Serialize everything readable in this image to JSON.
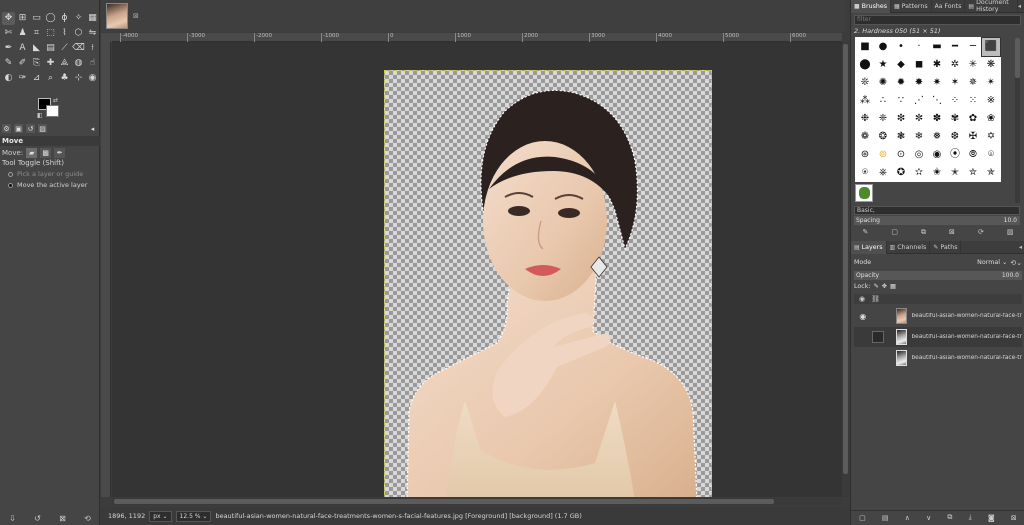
{
  "toolbox": {
    "tools": [
      {
        "name": "move-tool-icon",
        "glyph": "✥",
        "active": true
      },
      {
        "name": "align-tool-icon",
        "glyph": "⊞"
      },
      {
        "name": "rect-select-icon",
        "glyph": "▭"
      },
      {
        "name": "ellipse-select-icon",
        "glyph": "◯"
      },
      {
        "name": "free-select-icon",
        "glyph": "ϕ"
      },
      {
        "name": "fuzzy-select-icon",
        "glyph": "✧"
      },
      {
        "name": "select-by-color-icon",
        "glyph": "▦"
      },
      {
        "name": "scissors-select-icon",
        "glyph": "✄"
      },
      {
        "name": "foreground-select-icon",
        "glyph": "♟"
      },
      {
        "name": "crop-icon",
        "glyph": "⌗"
      },
      {
        "name": "unified-transform-icon",
        "glyph": "⬚"
      },
      {
        "name": "warp-transform-icon",
        "glyph": "⌇"
      },
      {
        "name": "cage-transform-icon",
        "glyph": "⬡"
      },
      {
        "name": "flip-icon",
        "glyph": "⇋"
      },
      {
        "name": "paths-icon",
        "glyph": "✒"
      },
      {
        "name": "text-icon",
        "glyph": "A"
      },
      {
        "name": "bucket-fill-icon",
        "glyph": "◣"
      },
      {
        "name": "gradient-icon",
        "glyph": "▤"
      },
      {
        "name": "paintbrush-icon",
        "glyph": "⟋"
      },
      {
        "name": "eraser-icon",
        "glyph": "⌫"
      },
      {
        "name": "airbrush-icon",
        "glyph": "⟊"
      },
      {
        "name": "ink-icon",
        "glyph": "✎"
      },
      {
        "name": "mypaint-brush-icon",
        "glyph": "✐"
      },
      {
        "name": "clone-icon",
        "glyph": "⎘"
      },
      {
        "name": "heal-icon",
        "glyph": "✚"
      },
      {
        "name": "perspective-clone-icon",
        "glyph": "⟁"
      },
      {
        "name": "blur-icon",
        "glyph": "◍"
      },
      {
        "name": "smudge-icon",
        "glyph": "☝"
      },
      {
        "name": "dodge-burn-icon",
        "glyph": "◐"
      },
      {
        "name": "color-picker-icon",
        "glyph": "✑"
      },
      {
        "name": "measure-icon",
        "glyph": "⊿"
      },
      {
        "name": "zoom-icon",
        "glyph": "⌕"
      },
      {
        "name": "levels-icon",
        "glyph": "♣"
      },
      {
        "name": "handle-transform-icon",
        "glyph": "⊹"
      },
      {
        "name": "threshold-icon",
        "glyph": "◉"
      }
    ],
    "options_title": "Move",
    "move_label": "Move:",
    "tool_toggle": "Tool Toggle  (Shift)",
    "option_pick": "Pick a layer or guide",
    "option_move": "Move the active layer"
  },
  "canvas": {
    "ruler_ticks": [
      "-4000",
      "-3000",
      "-2000",
      "-1000",
      "0",
      "1000",
      "2000",
      "3000",
      "4000",
      "5000",
      "6000"
    ],
    "image_file": "beautiful-asian-women-natural-face-treatments-women-s-facial-features.jpg"
  },
  "status": {
    "coords": "1896, 1192",
    "unit": "px",
    "zoom": "12.5 %",
    "message": "beautiful-asian-women-natural-face-treatments-women-s-facial-features.jpg [Foreground] [background] (1.7 GB)"
  },
  "dock": {
    "top_tabs": [
      {
        "name": "tab-brushes",
        "icon": "■",
        "label": "Brushes"
      },
      {
        "name": "tab-patterns",
        "icon": "▦",
        "label": "Patterns"
      },
      {
        "name": "tab-fonts",
        "icon": "Aa",
        "label": "Fonts"
      },
      {
        "name": "tab-document-history",
        "icon": "▤",
        "label": "Document History"
      }
    ],
    "filter_placeholder": "filter",
    "brush_name": "2. Hardness 050 (51 × 51)",
    "brush_tag": "Basic,",
    "spacing_label": "Spacing",
    "spacing_value": "10.0",
    "layer_tabs": [
      {
        "name": "tab-layers",
        "icon": "▤",
        "label": "Layers"
      },
      {
        "name": "tab-channels",
        "icon": "▥",
        "label": "Channels"
      },
      {
        "name": "tab-paths",
        "icon": "✎",
        "label": "Paths"
      }
    ],
    "mode_label": "Mode",
    "mode_value": "Normal",
    "opacity_label": "Opacity",
    "opacity_value": "100.0",
    "lock_label": "Lock:",
    "layers": [
      {
        "label": "beautiful-asian-women-natural-face-treatm",
        "visible": true,
        "mask": false,
        "selected": false
      },
      {
        "label": "beautiful-asian-women-natural-face-treatm",
        "visible": false,
        "mask": true,
        "selected": true
      },
      {
        "label": "beautiful-asian-women-natural-face-treatm",
        "visible": false,
        "mask": true,
        "selected": false
      }
    ]
  }
}
